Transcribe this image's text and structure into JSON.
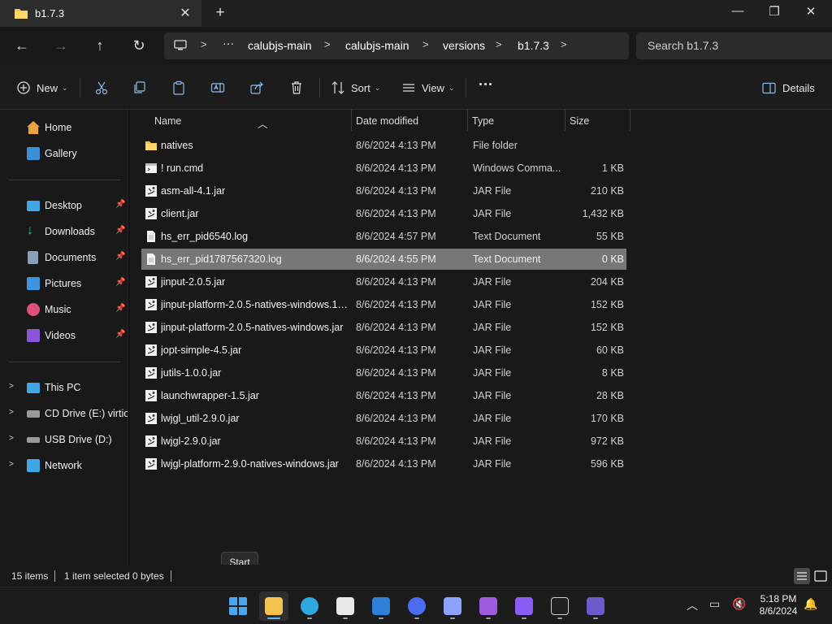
{
  "window": {
    "tab_title": "b1.7.3",
    "close_tab": "✕",
    "new_tab": "+",
    "minimize": "—",
    "maximize": "❐",
    "close": "✕"
  },
  "address": {
    "more": "···",
    "segments": [
      "calubjs-main",
      "calubjs-main",
      "versions",
      "b1.7.3"
    ],
    "search_placeholder": "Search b1.7.3"
  },
  "commands": {
    "new_label": "New",
    "sort_label": "Sort",
    "view_label": "View",
    "more": "···",
    "details_label": "Details"
  },
  "sidebar": {
    "quick": [
      {
        "label": "Home",
        "icon": "home-icon",
        "color": "#e8a33d"
      },
      {
        "label": "Gallery",
        "icon": "gallery-icon",
        "color": "#3b8fd9"
      }
    ],
    "pinned": [
      {
        "label": "Desktop",
        "icon": "desktop-icon",
        "color": "#3ea7e6"
      },
      {
        "label": "Downloads",
        "icon": "download-icon",
        "color": "#3fbf7a"
      },
      {
        "label": "Documents",
        "icon": "documents-icon",
        "color": "#8aa0b8"
      },
      {
        "label": "Pictures",
        "icon": "pictures-icon",
        "color": "#3d95e0"
      },
      {
        "label": "Music",
        "icon": "music-icon",
        "color": "#e0507a"
      },
      {
        "label": "Videos",
        "icon": "videos-icon",
        "color": "#8a55d6"
      }
    ],
    "drives": [
      {
        "label": "This PC",
        "icon": "pc-icon",
        "color": "#3ea7e6"
      },
      {
        "label": "CD Drive (E:) virtio-",
        "icon": "cd-drive-icon",
        "color": "#9a9a9a"
      },
      {
        "label": "USB Drive (D:)",
        "icon": "usb-drive-icon",
        "color": "#9a9a9a"
      },
      {
        "label": "Network",
        "icon": "network-icon",
        "color": "#3ea7e6"
      }
    ]
  },
  "columns": {
    "name": "Name",
    "date": "Date modified",
    "type": "Type",
    "size": "Size"
  },
  "files": [
    {
      "name": "natives",
      "date": "8/6/2024 4:13 PM",
      "type": "File folder",
      "size": "",
      "icon": "folder"
    },
    {
      "name": "! run.cmd",
      "date": "8/6/2024 4:13 PM",
      "type": "Windows Comma...",
      "size": "1 KB",
      "icon": "cmd"
    },
    {
      "name": "asm-all-4.1.jar",
      "date": "8/6/2024 4:13 PM",
      "type": "JAR File",
      "size": "210 KB",
      "icon": "jar"
    },
    {
      "name": "client.jar",
      "date": "8/6/2024 4:13 PM",
      "type": "JAR File",
      "size": "1,432 KB",
      "icon": "jar"
    },
    {
      "name": "hs_err_pid6540.log",
      "date": "8/6/2024 4:57 PM",
      "type": "Text Document",
      "size": "55 KB",
      "icon": "text"
    },
    {
      "name": "hs_err_pid1787567320.log",
      "date": "8/6/2024 4:55 PM",
      "type": "Text Document",
      "size": "0 KB",
      "icon": "text",
      "selected": true
    },
    {
      "name": "jinput-2.0.5.jar",
      "date": "8/6/2024 4:13 PM",
      "type": "JAR File",
      "size": "204 KB",
      "icon": "jar"
    },
    {
      "name": "jinput-platform-2.0.5-natives-windows.1....",
      "date": "8/6/2024 4:13 PM",
      "type": "JAR File",
      "size": "152 KB",
      "icon": "jar"
    },
    {
      "name": "jinput-platform-2.0.5-natives-windows.jar",
      "date": "8/6/2024 4:13 PM",
      "type": "JAR File",
      "size": "152 KB",
      "icon": "jar"
    },
    {
      "name": "jopt-simple-4.5.jar",
      "date": "8/6/2024 4:13 PM",
      "type": "JAR File",
      "size": "60 KB",
      "icon": "jar"
    },
    {
      "name": "jutils-1.0.0.jar",
      "date": "8/6/2024 4:13 PM",
      "type": "JAR File",
      "size": "8 KB",
      "icon": "jar"
    },
    {
      "name": "launchwrapper-1.5.jar",
      "date": "8/6/2024 4:13 PM",
      "type": "JAR File",
      "size": "28 KB",
      "icon": "jar"
    },
    {
      "name": "lwjgl_util-2.9.0.jar",
      "date": "8/6/2024 4:13 PM",
      "type": "JAR File",
      "size": "170 KB",
      "icon": "jar"
    },
    {
      "name": "lwjgl-2.9.0.jar",
      "date": "8/6/2024 4:13 PM",
      "type": "JAR File",
      "size": "972 KB",
      "icon": "jar"
    },
    {
      "name": "lwjgl-platform-2.9.0-natives-windows.jar",
      "date": "8/6/2024 4:13 PM",
      "type": "JAR File",
      "size": "596 KB",
      "icon": "jar"
    }
  ],
  "status": {
    "items": "15 items",
    "selected": "1 item selected",
    "bytes": "0 bytes"
  },
  "tooltip": "Start",
  "taskbar": {
    "apps": [
      {
        "name": "start-button",
        "color": "#4aa6f0"
      },
      {
        "name": "file-explorer",
        "color": "#f2c14e"
      },
      {
        "name": "edge-browser",
        "color": "#2fa8e0"
      },
      {
        "name": "microsoft-store",
        "color": "#e8e8e8"
      },
      {
        "name": "outlook-new",
        "color": "#2e7fd9"
      },
      {
        "name": "firefox",
        "color": "#4a6cf0"
      },
      {
        "name": "app-mountains",
        "color": "#8ea2ff"
      },
      {
        "name": "app-creature",
        "color": "#a05ae0"
      },
      {
        "name": "app-cube",
        "color": "#8b5cf6"
      },
      {
        "name": "terminal",
        "color": "#cccccc"
      },
      {
        "name": "app-ps",
        "color": "#6d59c9"
      }
    ],
    "time": "5:18 PM",
    "date": "8/6/2024"
  }
}
